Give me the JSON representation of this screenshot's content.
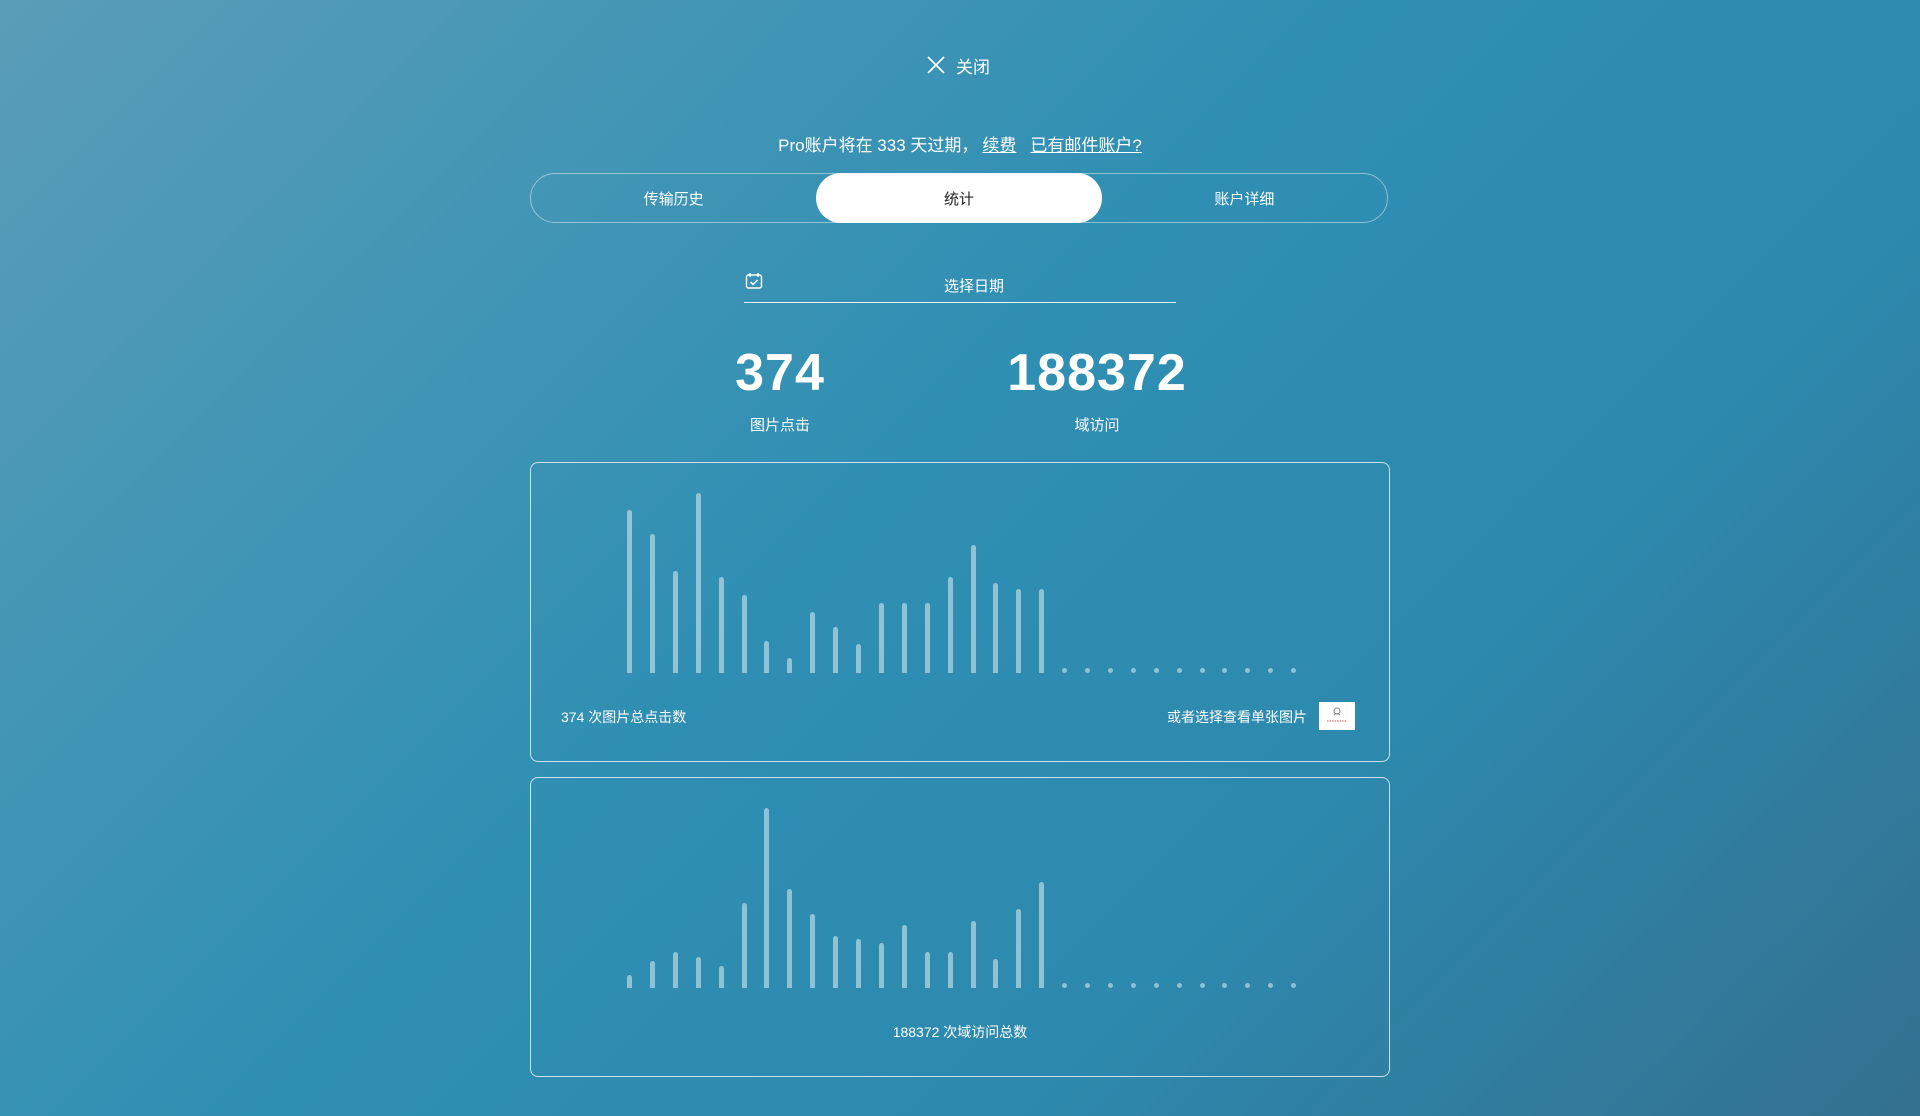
{
  "close": {
    "label": "关闭",
    "icon": "close-icon"
  },
  "notice": {
    "text": "Pro账户将在 333 天过期，",
    "renew": "续费",
    "email_account": "已有邮件账户?"
  },
  "tabs": [
    {
      "label": "传输历史",
      "active": false
    },
    {
      "label": "统计",
      "active": true
    },
    {
      "label": "账户详细",
      "active": false
    }
  ],
  "date_picker": {
    "label": "选择日期",
    "icon": "calendar-icon"
  },
  "stats": {
    "image_clicks": {
      "value": "374",
      "label": "图片点击"
    },
    "domain_visits": {
      "value": "188372",
      "label": "域访问"
    }
  },
  "panel_clicks": {
    "footer_left": "374 次图片总点击数",
    "footer_right": "或者选择查看单张图片"
  },
  "panel_visits": {
    "footer_center": "188372 次域访问总数"
  },
  "chart_data": [
    {
      "type": "bar",
      "values": [
        56,
        48,
        35,
        62,
        33,
        27,
        11,
        5,
        21,
        16,
        10,
        24,
        24,
        24,
        33,
        44,
        31,
        29,
        29,
        0,
        0,
        0,
        0,
        0,
        0,
        0,
        0,
        0,
        0,
        0
      ],
      "ylim": [
        0,
        62
      ],
      "grid": false
    },
    {
      "type": "bar",
      "values": [
        6,
        12,
        16,
        14,
        10,
        38,
        80,
        44,
        33,
        23,
        22,
        20,
        28,
        16,
        16,
        30,
        13,
        35,
        47,
        0,
        0,
        0,
        0,
        0,
        0,
        0,
        0,
        0,
        0,
        0
      ],
      "ylim": [
        0,
        80
      ],
      "grid": false
    }
  ],
  "colors": {
    "bar": "#cde4ee",
    "active_tab_bg": "#ffffff",
    "active_tab_text": "#222222"
  }
}
